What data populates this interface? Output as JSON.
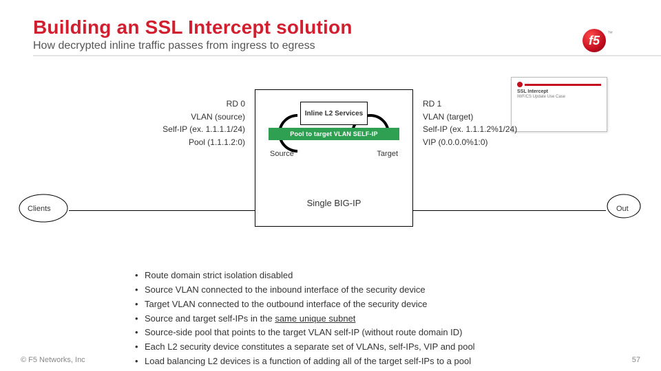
{
  "header": {
    "title": "Building an SSL Intercept solution",
    "subtitle": "How decrypted inline traffic passes from ingress to egress"
  },
  "logo": {
    "glyph": "f5",
    "tm": "™"
  },
  "preview_card": {
    "title": "SSL Intercept",
    "subtitle": "IWF/CS Update Use Case"
  },
  "diagram": {
    "left_spec": {
      "rd": "RD 0",
      "vlan": "VLAN (source)",
      "selfip": "Self-IP (ex. 1.1.1.1/24)",
      "pool": "Pool (1.1.1.2:0)"
    },
    "right_spec": {
      "rd": "RD 1",
      "vlan": "VLAN (target)",
      "selfip": "Self-IP (ex. 1.1.1.2%1/24)",
      "vip": "VIP (0.0.0.0%1:0)"
    },
    "inline_box": "Inline L2 Services",
    "pool_bar": "Pool to target VLAN SELF-IP",
    "source_label": "Source",
    "target_label": "Target",
    "bigbox_label": "Single BIG-IP",
    "cloud_left": "Clients",
    "cloud_right": "Out"
  },
  "bullets": [
    "Route domain strict isolation disabled",
    "Source VLAN connected to the inbound interface of the security device",
    "Target VLAN connected to the outbound interface of the security device",
    "Source and target self-IPs in the <u>same unique subnet</u>",
    "Source-side pool that points to the target VLAN self-IP (without route domain ID)",
    "Each L2 security device constitutes a separate set of VLANs, self-IPs, VIP and pool",
    "Load balancing L2 devices is a function of adding all of the target self-IPs to a pool"
  ],
  "footer": {
    "copyright": "© F5 Networks, Inc",
    "page": "57"
  }
}
